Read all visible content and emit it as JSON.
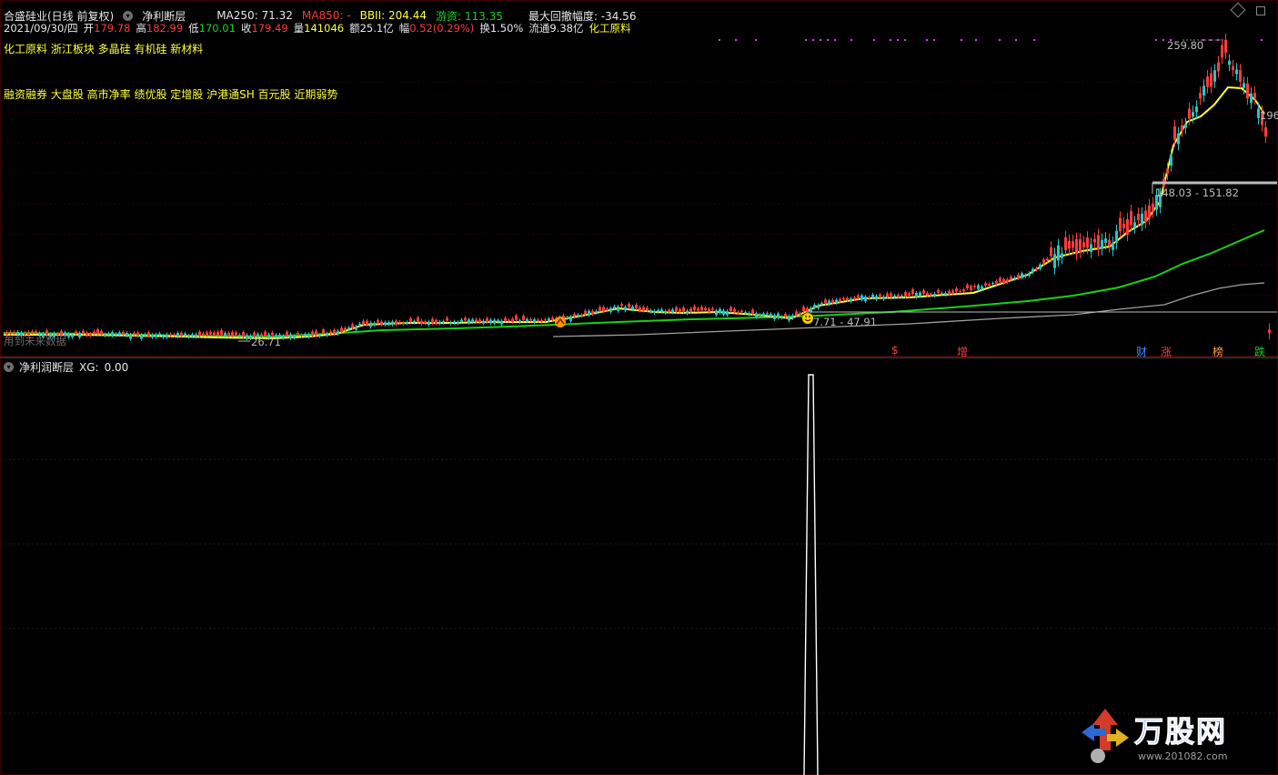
{
  "header": {
    "stock_title": "合盛硅业(日线 前复权)",
    "indicator_name": "净利断层",
    "ma250_label": "MA250:",
    "ma250_value": "71.32",
    "ma850_label": "MA850:",
    "ma850_value": "-",
    "bbi_label": "BBII:",
    "bbi_value": "204.44",
    "youzi_label": "游资:",
    "youzi_value": "113.35",
    "drawdown_label": "最大回撤幅度:",
    "drawdown_value": "-34.56"
  },
  "quote": {
    "date": "2021/09/30/四",
    "open_label": "开",
    "open": "179.78",
    "high_label": "高",
    "high": "182.99",
    "low_label": "低",
    "low": "170.01",
    "close_label": "收",
    "close": "179.49",
    "volume_label": "量",
    "volume": "141046",
    "amount_label": "额",
    "amount": "25.1亿",
    "change_label": "幅",
    "change": "0.52(0.29%)",
    "turnover_label": "换",
    "turnover": "1.50%",
    "float_label": "流通",
    "float": "9.38亿",
    "industry": "化工原料"
  },
  "tags": {
    "line1": "化工原料 浙江板块 多晶硅 有机硅 新材料",
    "line2": "融资融券 大盘股 高市净率 绩优股 定增股 沪港通SH 百元股 近期弱势"
  },
  "annotations": {
    "price_high": "259.80",
    "price_range_upper": "148.03 - 151.82",
    "price_range_lower": "7.71 - 47.91",
    "price_low": "26.71",
    "right_value": "196",
    "future_data": "用到未来数据"
  },
  "events": [
    {
      "label": "$",
      "color": "#ff3b3b"
    },
    {
      "label": "增",
      "color": "#ff3b3b"
    },
    {
      "label": "财",
      "color": "#3c8cff"
    },
    {
      "label": "涨",
      "color": "#ff3b3b"
    },
    {
      "label": "榜",
      "color": "#ff9c3c"
    },
    {
      "label": "跌",
      "color": "#18d018"
    }
  ],
  "sub_panel": {
    "title": "净利润断层",
    "xg_label": "XG:",
    "xg_value": "0.00"
  },
  "watermark": {
    "brand": "万股网",
    "url": "www.201082.com"
  },
  "colors": {
    "up": "#ff3b3b",
    "down": "#26c6c6",
    "ma_yellow": "#ffff3c",
    "ma_green": "#18d018",
    "ma_gray": "#a0a0a0",
    "magenta": "#e040e0"
  }
}
